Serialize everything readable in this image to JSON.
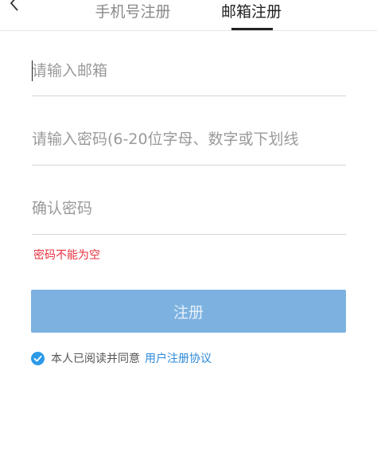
{
  "header": {
    "tabs": [
      {
        "label": "手机号注册",
        "active": false
      },
      {
        "label": "邮箱注册",
        "active": true
      }
    ]
  },
  "form": {
    "email_placeholder": "请输入邮箱",
    "password_placeholder": "请输入密码(6-20位字母、数字或下划线",
    "confirm_placeholder": "确认密码",
    "error_message": "密码不能为空",
    "submit_label": "注册",
    "agree_text": "本人已阅读并同意",
    "agree_link": "用户注册协议",
    "agree_checked": true
  },
  "colors": {
    "accent": "#2b8ad9",
    "button": "#7db2e0",
    "error": "#e8303f"
  }
}
